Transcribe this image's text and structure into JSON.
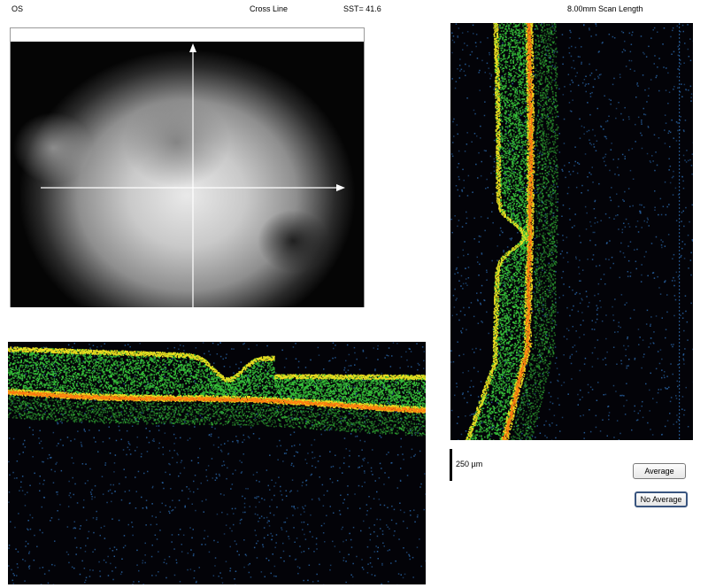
{
  "header": {
    "eye": "OS",
    "scan_type": "Cross Line",
    "sst": "SST= 41.6",
    "scan_length": "8.00mm Scan Length"
  },
  "fundus": {
    "crosshair_icon": "crosshair-arrows-icon"
  },
  "oct": {
    "horizontal_scan": "horizontal-oct-bscan",
    "vertical_scan": "vertical-oct-bscan",
    "colors": {
      "retina_green": "#38c43a",
      "retina_yellow": "#f0e020",
      "rpe_orange": "#ff7a10",
      "noise_blue": "#2a66a8",
      "background": "#030308"
    }
  },
  "scale": {
    "label": "250 µm"
  },
  "buttons": {
    "average": "Average",
    "no_average": "No Average"
  }
}
